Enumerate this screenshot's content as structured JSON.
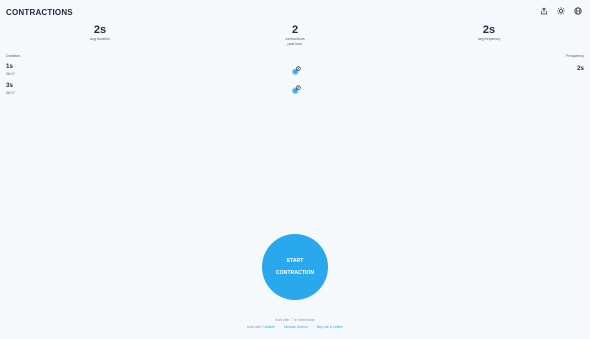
{
  "app": {
    "title": "CONTRACTIONS"
  },
  "header_icons": [
    "share-icon",
    "sun-icon",
    "globe-icon"
  ],
  "stats": {
    "duration": {
      "value": "2s",
      "label": "avg duration"
    },
    "count": {
      "value": "2",
      "label1": "contractions",
      "label2": "past hour"
    },
    "frequency": {
      "value": "2s",
      "label": "avg frequency"
    }
  },
  "table": {
    "duration_header": "Duration",
    "frequency_header": "Frequency",
    "rows": [
      {
        "duration": "1s",
        "time": "06:17",
        "frequency": "2s"
      },
      {
        "duration": "3s",
        "time": "06:17",
        "frequency": ""
      }
    ]
  },
  "start_button": {
    "line1": "START",
    "line2": "CONTRACTION"
  },
  "footer": {
    "line1": "built with ♡ in Barcelona",
    "built_with": "built with:",
    "link1": "Unable",
    "link2": "Nicolas Giorno",
    "link3": "Buy me a coffee",
    "separator": "·"
  },
  "colors": {
    "accent": "#29a8ee",
    "text": "#1f2a3c",
    "muted": "#555e6b",
    "background": "#f6f9fc"
  }
}
